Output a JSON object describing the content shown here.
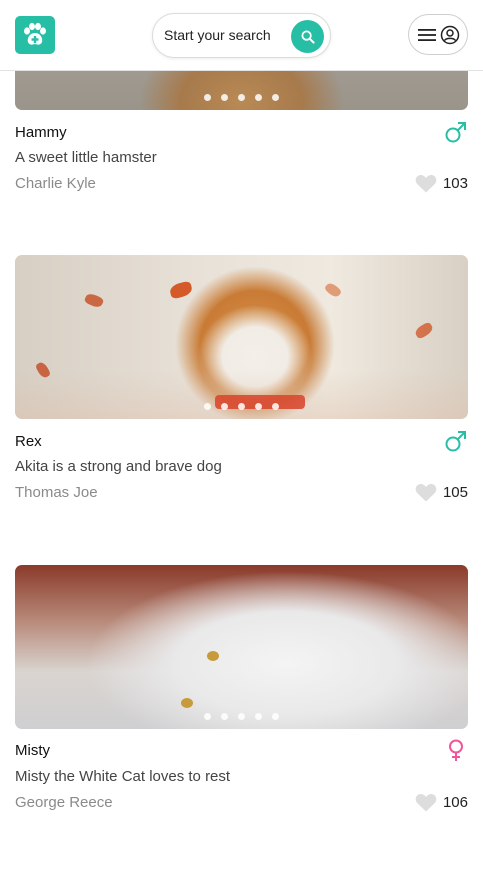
{
  "header": {
    "logo_icon": "paw-plus-icon",
    "search_label": "Start your search",
    "search_icon": "search-icon",
    "menu_icon": "hamburger-icon",
    "account_icon": "user-circle-icon"
  },
  "colors": {
    "brand": "#26bfa6",
    "male": "#26bfa6",
    "female": "#f2569a",
    "heart": "#dddddd"
  },
  "pets": [
    {
      "name": "Hammy",
      "description": "A sweet little hamster",
      "owner": "Charlie Kyle",
      "likes": "103",
      "gender": "male",
      "photo_dots": 5
    },
    {
      "name": "Rex",
      "description": "Akita is a strong and brave dog",
      "owner": "Thomas Joe",
      "likes": "105",
      "gender": "male",
      "photo_dots": 5
    },
    {
      "name": "Misty",
      "description": "Misty the White Cat loves to rest",
      "owner": "George Reece",
      "likes": "106",
      "gender": "female",
      "photo_dots": 5
    }
  ]
}
